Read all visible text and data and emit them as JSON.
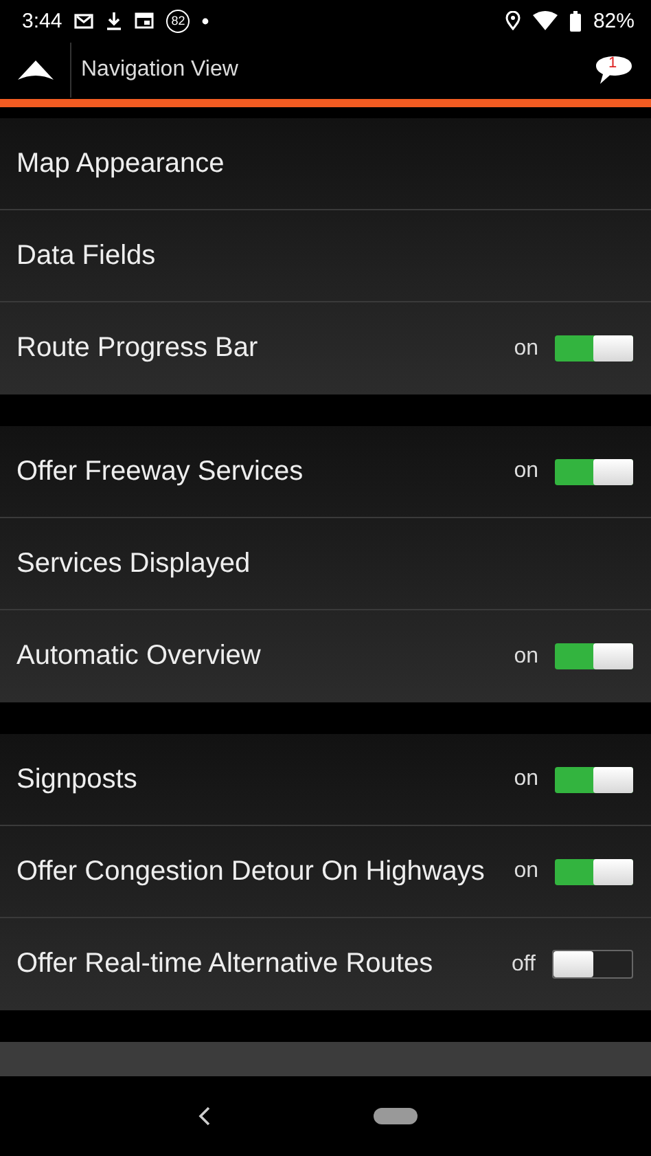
{
  "status_bar": {
    "time": "3:44",
    "notification_count": "82",
    "battery": "82%"
  },
  "header": {
    "title": "Navigation View",
    "badge": "1"
  },
  "groups": [
    {
      "items": [
        {
          "kind": "link",
          "label": "Map Appearance"
        },
        {
          "kind": "link",
          "label": "Data Fields"
        },
        {
          "kind": "toggle",
          "label": "Route Progress Bar",
          "state_label": "on",
          "on": true
        }
      ]
    },
    {
      "items": [
        {
          "kind": "toggle",
          "label": "Offer Freeway Services",
          "state_label": "on",
          "on": true
        },
        {
          "kind": "link",
          "label": "Services Displayed"
        },
        {
          "kind": "toggle",
          "label": "Automatic Overview",
          "state_label": "on",
          "on": true
        }
      ]
    },
    {
      "items": [
        {
          "kind": "toggle",
          "label": "Signposts",
          "state_label": "on",
          "on": true
        },
        {
          "kind": "toggle",
          "label": "Offer Congestion Detour On Highways",
          "state_label": "on",
          "on": true
        },
        {
          "kind": "toggle",
          "label": "Offer Real-time Alternative Routes",
          "state_label": "off",
          "on": false
        }
      ]
    }
  ]
}
